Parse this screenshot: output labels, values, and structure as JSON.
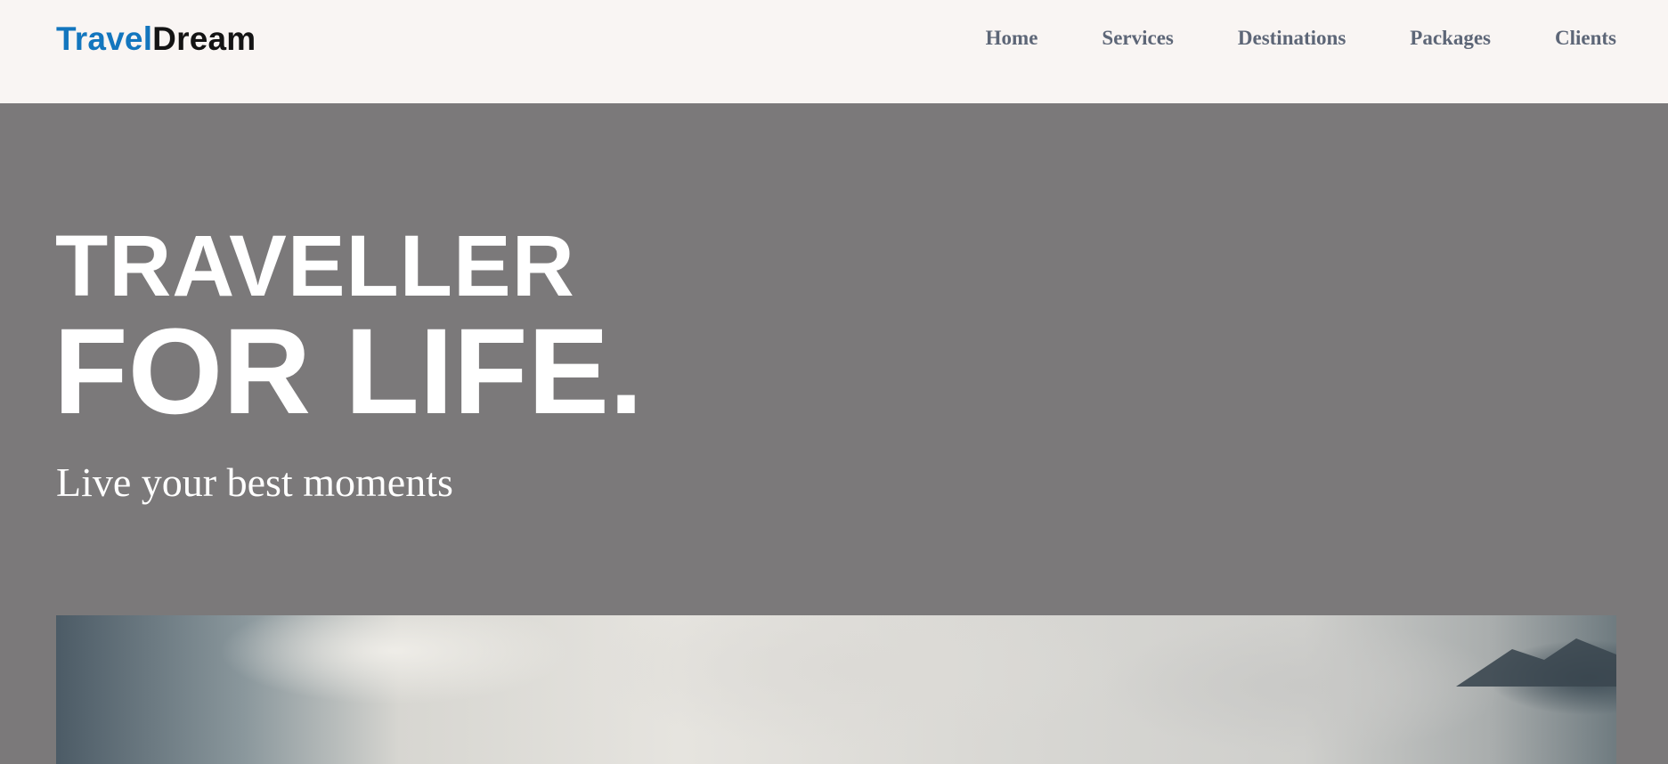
{
  "brand": {
    "part1": "Travel",
    "part2": "Dream",
    "colors": {
      "part1": "#1376be",
      "part2": "#141414"
    }
  },
  "nav": {
    "items": [
      {
        "label": "Home"
      },
      {
        "label": "Services"
      },
      {
        "label": "Destinations"
      },
      {
        "label": "Packages"
      },
      {
        "label": "Clients"
      }
    ]
  },
  "hero": {
    "line1": "TRAVELLER",
    "line2": "FOR LIFE.",
    "subtitle": "Live your best moments",
    "background_color": "#7b797a"
  },
  "colors": {
    "navbar_bg": "#f9f5f3",
    "nav_text": "#5d6677",
    "hero_text": "#ffffff"
  }
}
